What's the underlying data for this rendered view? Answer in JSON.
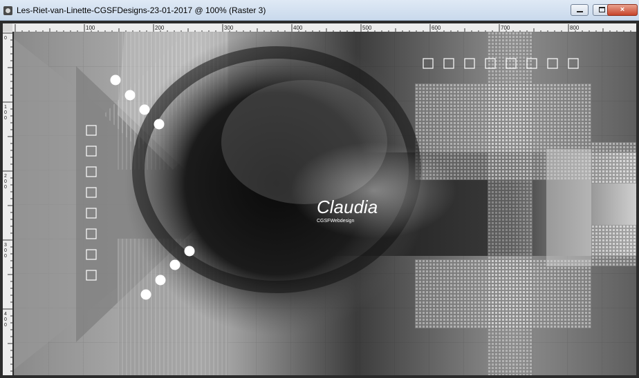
{
  "window": {
    "title": "Les-Riet-van-Linette-CGSFDesigns-23-01-2017 @ 100% (Raster 3)",
    "app_icon": "camera-icon",
    "controls": {
      "minimize": "minimize-icon",
      "maximize": "maximize-icon",
      "close": "×"
    }
  },
  "rulers": {
    "top_labels": [
      "100",
      "200",
      "300",
      "400",
      "500",
      "600",
      "700",
      "800"
    ],
    "left_labels": [
      "0",
      "100",
      "200",
      "300",
      "400"
    ]
  },
  "artwork": {
    "signature": "Claudia",
    "signature_sub": "CGSFWebdesign",
    "colors": {
      "dark": "#111111",
      "mid": "#6e6e6e",
      "light": "#d9d9d9",
      "white": "#ffffff"
    }
  }
}
